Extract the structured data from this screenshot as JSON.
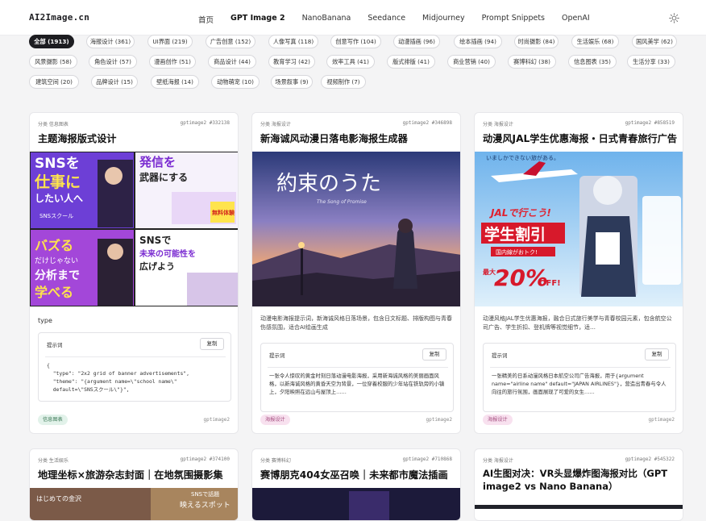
{
  "header": {
    "logo": "AI2Image.cn",
    "nav": [
      "首页",
      "GPT Image 2",
      "NanoBanana",
      "Seedance",
      "Midjourney",
      "Prompt Snippets",
      "OpenAI"
    ],
    "theme_icon": "sun-icon"
  },
  "filters": [
    "全部 (1913)",
    "海报设计 (361)",
    "UI界面 (219)",
    "广告创意 (152)",
    "人像写真 (118)",
    "创意写作 (104)",
    "动漫插画 (96)",
    "绘本插画 (94)",
    "时尚摄影 (84)",
    "生活娱乐 (68)",
    "国风美学 (62)",
    "风景摄影 (58)",
    "角色设计 (57)",
    "漫画创作 (51)",
    "商品设计 (44)",
    "教育学习 (42)",
    "效率工具 (41)",
    "版式排版 (41)",
    "商业营销 (40)",
    "赛博科幻 (38)",
    "信息图表 (35)",
    "生活分享 (33)",
    "建筑空间 (20)",
    "品牌设计 (15)",
    "壁纸海报 (14)",
    "动物萌宠 (10)",
    "场景叙事 (9)",
    "视频制作 (7)"
  ],
  "cards": [
    {
      "category": "分类 信息图表",
      "id": "gptimage2 #332138",
      "title": "主题海报版式设计",
      "image_text": {
        "a": "SNSを",
        "b": "仕事に",
        "c": "したい人へ",
        "d": "発信を",
        "e": "武器にする",
        "f": "無料体験",
        "g": "SNSで",
        "h": "未来の可能性を",
        "i": "広げよう",
        "j": "バズる",
        "k": "だけじゃない",
        "l": "分析まで",
        "m": "学べる",
        "n": "SNSスクール"
      },
      "type_label": "type",
      "prompt_label": "提示词",
      "copy_label": "复制",
      "prompt": "{\n  \"type\": \"2x2 grid of banner advertisements\",\n  \"theme\": \"{argument name=\\\"school name\\\"\n  default=\\\"SNSスクール\\\"}\",",
      "tag": "信息图表",
      "author": "gptimage2"
    },
    {
      "category": "分类 海报设计",
      "id": "gptimage2 #346898",
      "title": "新海诚风动漫日落电影海报生成器",
      "image_text": {
        "a": "約束のうた",
        "b": "The Song of Promise"
      },
      "desc": "动漫电影海报提示词，新海诚风格日落场景，包含日文标题、排版构图与青春伤感氛围，适合AI绘画生成",
      "prompt_label": "提示词",
      "copy_label": "复制",
      "prompt": "一张令人惊叹的黄金时刻日落动漫电影海报，采用新海诚风格的美丽画面风格，以新海诚风格的黄昏天空为背景，一位穿着校服的少年站在铁轨旁的小镇上，夕阳映照在远山与屋顶上……",
      "tag": "海报设计",
      "author": "gptimage2"
    },
    {
      "category": "分类 海报设计",
      "id": "gptimage2 #858519",
      "title": "动漫风JAL学生优惠海报・日式青春旅行广告",
      "image_text": {
        "a": "いましかできない旅がある。",
        "b": "JALで行こう!",
        "c": "学生割引",
        "d": "国内線がおトク!",
        "e": "最大",
        "f": "20%",
        "g": "OFF!"
      },
      "desc": "动漫风格JAL学生优惠海报，融合日式旅行美学与青春校园元素，包含航空公司广告、学生折扣、登机牌等视觉细节，适…",
      "prompt_label": "提示词",
      "copy_label": "复制",
      "prompt": "一张精美的日系动漫风格日本航空公司广告海报，用于{argument name=\"airline name\" default=\"JAPAN AIRLINES\"}，营造出青春与令人向往的旅行氛围，画面展现了可爱的女生……",
      "tag": "海报设计",
      "author": "gptimage2"
    },
    {
      "category": "分类 生活娱乐",
      "id": "gptimage2 #374100",
      "title": "地理坐标×旅游杂志封面｜在地氛围摄影集",
      "image_text": {
        "a": "はじめての金沢",
        "b": "SNSで話題",
        "c": "映えるスポット"
      }
    },
    {
      "category": "分类 赛博科幻",
      "id": "gptimage2 #710868",
      "title": "赛博朋克404女巫召唤｜未来都市魔法插画"
    },
    {
      "category": "分类 海报设计",
      "id": "gptimage2 #545322",
      "title_line1": "AI生图对决：VR头显爆炸图海报对比（GPT",
      "title_line2": "image2 vs Nano Banana）"
    }
  ],
  "colors": {
    "accent_dark": "#1d1d21",
    "tag_green": "#3d7a57",
    "tag_pink": "#a2487c"
  }
}
